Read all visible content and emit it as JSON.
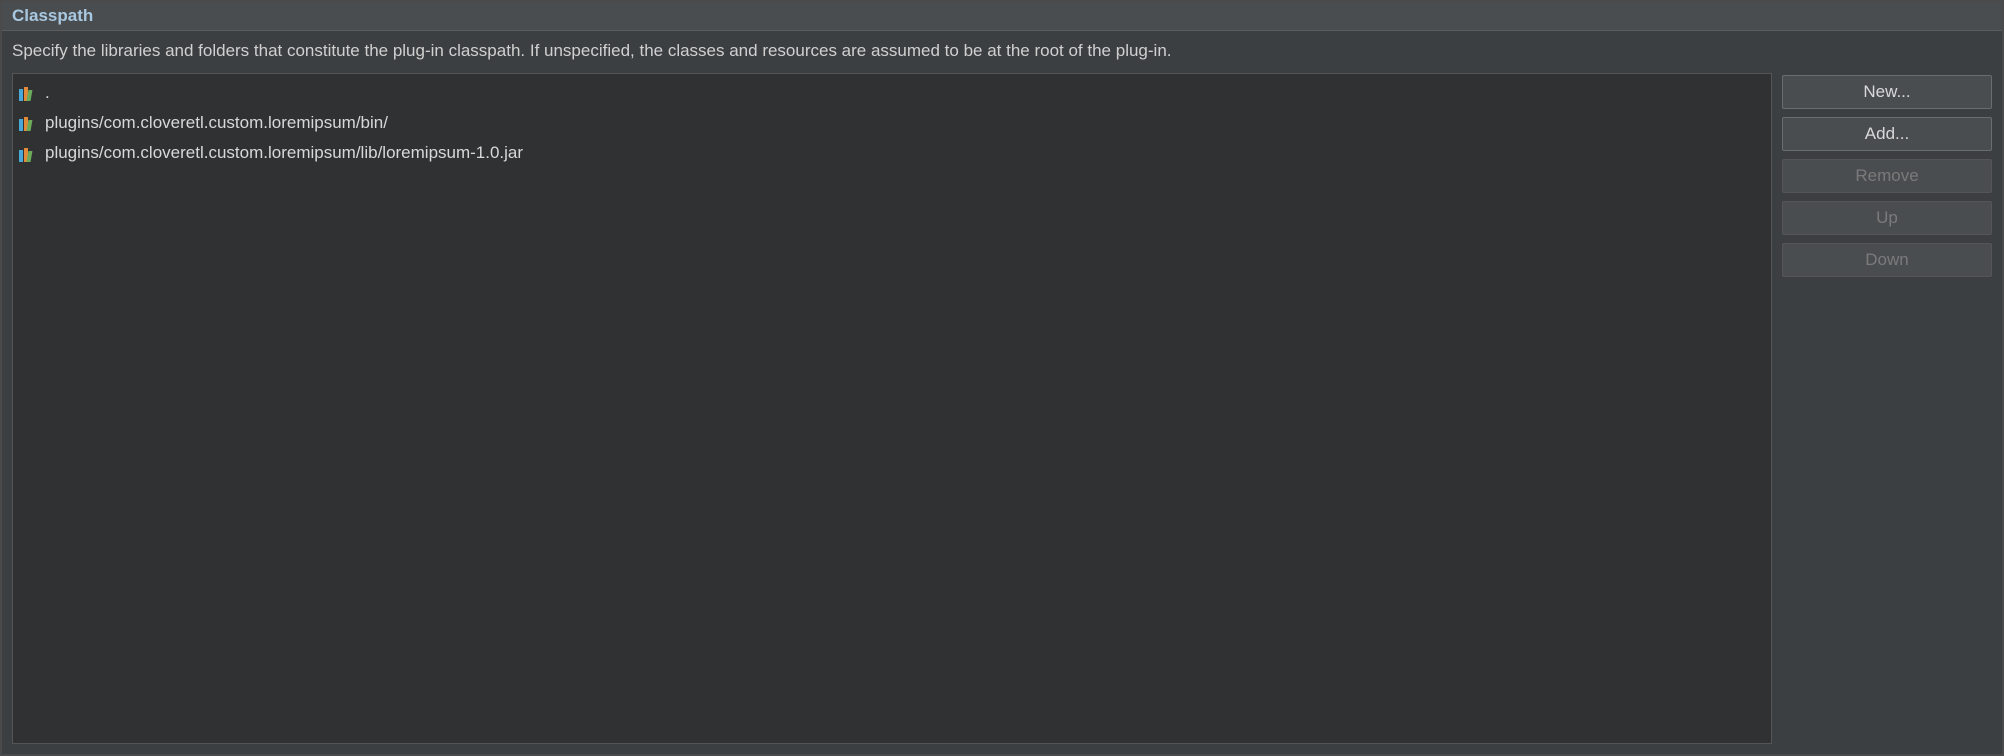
{
  "section": {
    "title": "Classpath",
    "description": "Specify the libraries and folders that constitute the plug-in classpath.  If unspecified, the classes and resources are assumed to be at the root of the plug-in."
  },
  "entries": [
    {
      "path": "."
    },
    {
      "path": "plugins/com.cloveretl.custom.loremipsum/bin/"
    },
    {
      "path": "plugins/com.cloveretl.custom.loremipsum/lib/loremipsum-1.0.jar"
    }
  ],
  "buttons": {
    "new": "New...",
    "add": "Add...",
    "remove": "Remove",
    "up": "Up",
    "down": "Down"
  }
}
